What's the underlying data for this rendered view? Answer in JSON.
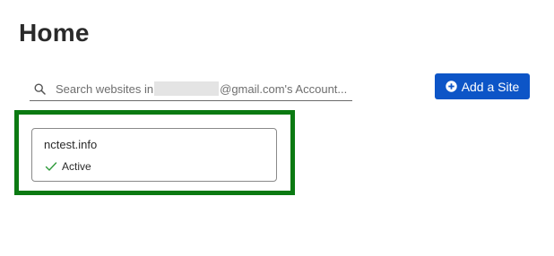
{
  "header": {
    "title": "Home"
  },
  "search": {
    "prefix": "Search websites in",
    "suffix": "@gmail.com's Account..."
  },
  "toolbar": {
    "add_site_label": "Add a Site"
  },
  "sites": [
    {
      "name": "nctest.info",
      "status": "Active"
    }
  ],
  "colors": {
    "primary_button": "#0d55c7",
    "highlight_border": "#0b7a12",
    "status_check": "#2e9a3a"
  },
  "icons": {
    "search": "search-icon",
    "add": "plus-circle-icon",
    "status": "check-icon"
  }
}
